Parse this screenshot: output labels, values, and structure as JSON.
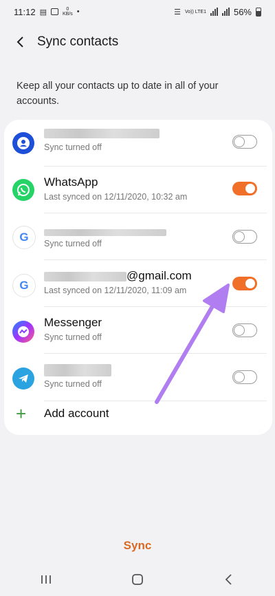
{
  "status_bar": {
    "time": "11:12",
    "speed_unit": "KB/s",
    "network_label": "Vo)) LTE1",
    "battery": "56%"
  },
  "header": {
    "title": "Sync contacts",
    "back_icon": "chevron-left-icon"
  },
  "description": "Keep all your contacts up to date in all of your accounts.",
  "accounts": [
    {
      "icon": "samsung-account-icon",
      "title": "",
      "subtitle": "Sync turned off",
      "sync_on": false
    },
    {
      "icon": "whatsapp-icon",
      "title": "WhatsApp",
      "subtitle": "Last synced on 12/11/2020, 10:32 am",
      "sync_on": true
    },
    {
      "icon": "google-icon",
      "title": "",
      "subtitle": "Sync turned off",
      "sync_on": false
    },
    {
      "icon": "google-icon",
      "title": "@gmail.com",
      "subtitle": "Last synced on 12/11/2020, 11:09 am",
      "sync_on": true
    },
    {
      "icon": "messenger-icon",
      "title": "Messenger",
      "subtitle": "Sync turned off",
      "sync_on": false
    },
    {
      "icon": "telegram-icon",
      "title": "",
      "subtitle": "Sync turned off",
      "sync_on": false
    }
  ],
  "add_account_label": "Add account",
  "sync_button": "Sync",
  "colors": {
    "accent": "#f0702a",
    "sync_text": "#d86a25",
    "annotation_arrow": "#b07ef0"
  }
}
